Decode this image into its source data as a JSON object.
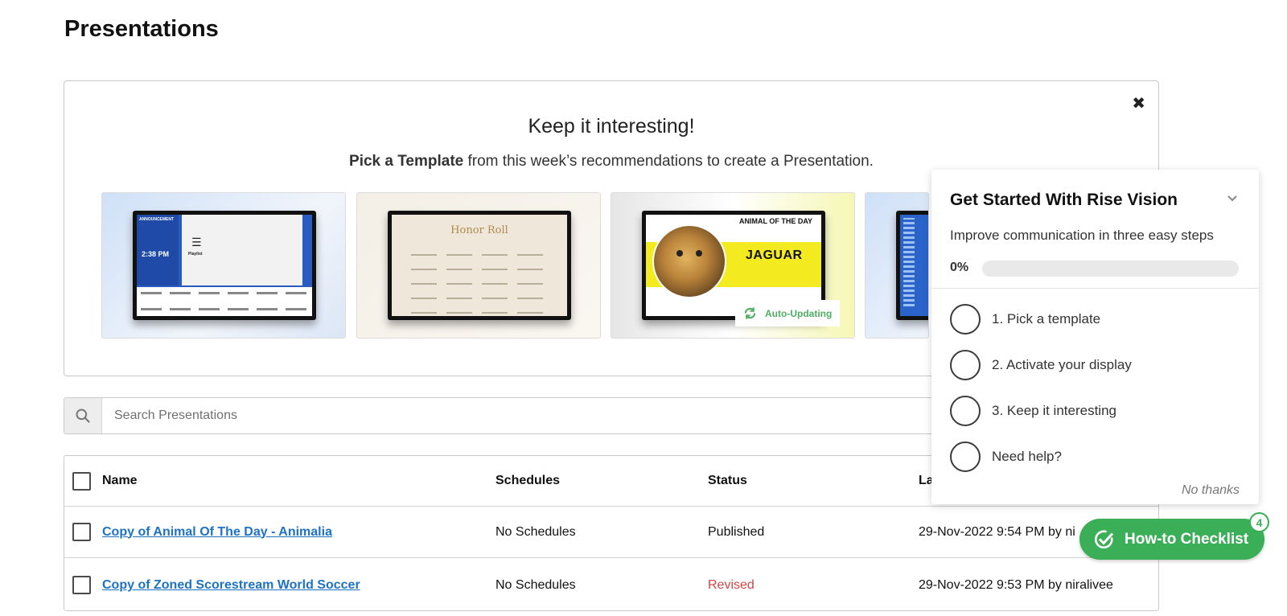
{
  "page": {
    "title": "Presentations"
  },
  "banner": {
    "heading": "Keep it interesting!",
    "sub_bold": "Pick a Template",
    "sub_rest": " from this week’s recommendations to create a Presentation.",
    "close_glyph": "✖",
    "templates": [
      {
        "name": "announcement-playlist",
        "announcement": "ANNOUNCEMENT",
        "time": "2:38 PM",
        "playlist": "Playlist"
      },
      {
        "name": "honor-roll",
        "title": "Honor Roll"
      },
      {
        "name": "animal-of-the-day",
        "header": "ANIMAL OF THE DAY",
        "animal": "JAGUAR",
        "badge": "Auto-Updating"
      },
      {
        "name": "partial-template"
      }
    ]
  },
  "search": {
    "placeholder": "Search Presentations",
    "value": ""
  },
  "table": {
    "columns": {
      "name": "Name",
      "schedules": "Schedules",
      "status": "Status",
      "last": "La"
    },
    "rows": [
      {
        "name": "Copy of Animal Of The Day - Animalia",
        "schedules": "No Schedules",
        "status": "Published",
        "last": "29-Nov-2022 9:54 PM by ni"
      },
      {
        "name": "Copy of Zoned Scorestream World Soccer",
        "schedules": "No Schedules",
        "status": "Revised",
        "last": "29-Nov-2022 9:53 PM by niralivee"
      }
    ]
  },
  "onboarding": {
    "title": "Get Started With Rise Vision",
    "subtitle": "Improve communication in three easy steps",
    "progress_label": "0%",
    "progress": 0,
    "steps": [
      "1. Pick a template",
      "2. Activate your display",
      "3. Keep it interesting",
      "Need help?"
    ],
    "dismiss": "No thanks"
  },
  "checklist": {
    "label": "How-to Checklist",
    "count": "4"
  },
  "colors": {
    "accent_green": "#3aaf57",
    "link_blue": "#1d72c4",
    "revised_red": "#d64545"
  }
}
